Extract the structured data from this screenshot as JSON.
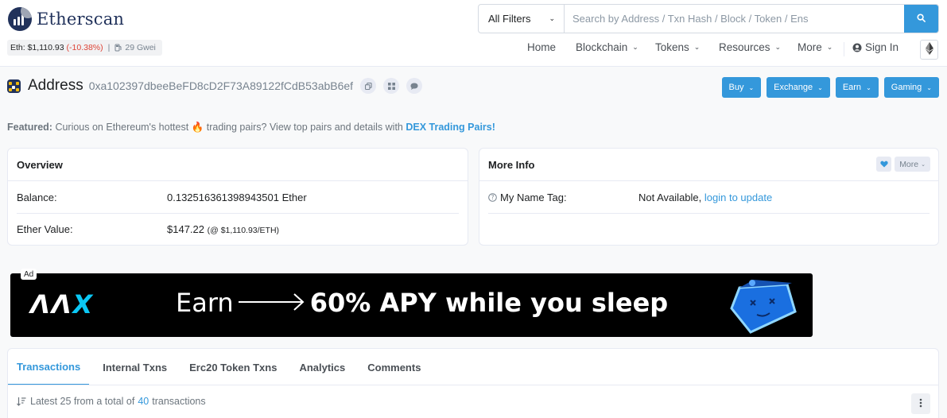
{
  "brand": {
    "name": "Etherscan"
  },
  "price_bar": {
    "eth_label": "Eth: $1,110.93",
    "change": "(-10.38%)",
    "separator": "|",
    "gas": "29 Gwei"
  },
  "search": {
    "filter_label": "All Filters",
    "placeholder": "Search by Address / Txn Hash / Block / Token / Ens"
  },
  "nav": {
    "items": [
      {
        "label": "Home"
      },
      {
        "label": "Blockchain"
      },
      {
        "label": "Tokens"
      },
      {
        "label": "Resources"
      },
      {
        "label": "More"
      }
    ],
    "sign_in": "Sign In"
  },
  "address": {
    "title": "Address",
    "hash": "0xa102397dbeeBeFD8cD2F73A89122fCdB53abB6ef"
  },
  "actions": [
    {
      "label": "Buy"
    },
    {
      "label": "Exchange"
    },
    {
      "label": "Earn"
    },
    {
      "label": "Gaming"
    }
  ],
  "featured": {
    "prefix": "Featured:",
    "text1": "Curious on Ethereum's hottest",
    "text2": "trading pairs? View top pairs and details with",
    "link": "DEX Trading Pairs!"
  },
  "overview": {
    "title": "Overview",
    "balance_label": "Balance:",
    "balance_value": "0.132516361398943501 Ether",
    "value_label": "Ether Value:",
    "value_amount": "$147.22",
    "value_rate": "(@ $1,110.93/ETH)"
  },
  "more_info": {
    "title": "More Info",
    "more_label": "More",
    "tag_label": "My Name Tag:",
    "tag_value": "Not Available,",
    "tag_link": "login to update"
  },
  "ad": {
    "tag": "Ad",
    "brand_main": "ΛΛ",
    "brand_x": "X",
    "text_earn": "Earn",
    "text_rest": "60% APY while you sleep"
  },
  "tabs": [
    {
      "label": "Transactions"
    },
    {
      "label": "Internal Txns"
    },
    {
      "label": "Erc20 Token Txns"
    },
    {
      "label": "Analytics"
    },
    {
      "label": "Comments"
    }
  ],
  "tx_summary": {
    "prefix": "Latest 25 from a total of",
    "count": "40",
    "suffix": "transactions"
  },
  "colors": {
    "accent": "#3498db",
    "navy": "#21325b",
    "negative": "#de4437",
    "ad_accent": "#0bc8f5"
  }
}
